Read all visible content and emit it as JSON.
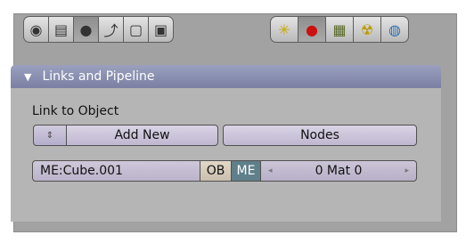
{
  "toolbar": {
    "left_group": [
      {
        "icon": "logic-icon",
        "glyph": "◉"
      },
      {
        "icon": "script-icon",
        "glyph": "▤"
      },
      {
        "icon": "shading-icon",
        "glyph": "●",
        "active": true
      },
      {
        "icon": "object-icon",
        "glyph": "⤴"
      },
      {
        "icon": "editing-icon",
        "glyph": "▢"
      },
      {
        "icon": "scene-icon",
        "glyph": "▣"
      }
    ],
    "right_group": [
      {
        "icon": "lamp-icon",
        "glyph": "✳"
      },
      {
        "icon": "material-icon",
        "glyph": "●",
        "active": true
      },
      {
        "icon": "texture-icon",
        "glyph": "▦"
      },
      {
        "icon": "radiosity-icon",
        "glyph": "☢"
      },
      {
        "icon": "world-icon",
        "glyph": "◍"
      }
    ]
  },
  "panel": {
    "title": "Links and Pipeline",
    "section_label": "Link to Object",
    "add_new": "Add New",
    "nodes": "Nodes",
    "mesh_field": "ME:Cube.001",
    "ob_label": "OB",
    "me_label": "ME",
    "mat_left_arrow": "◂",
    "mat_value": "0 Mat 0",
    "mat_right_arrow": "▸"
  },
  "colors": {
    "header": "#8389aa",
    "me_active": "#5f7f8a"
  }
}
